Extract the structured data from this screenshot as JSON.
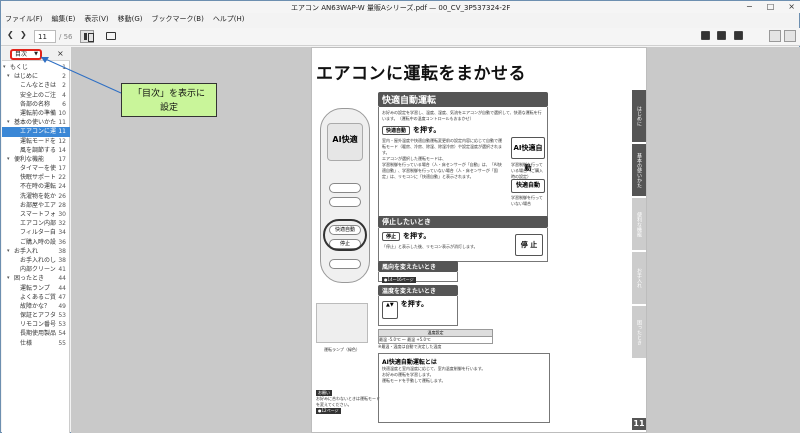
{
  "window": {
    "title": "エアコン AN63WAP-W 量販Aシリーズ.pdf — 00_CV_3P537324-2F",
    "buttons": [
      "−",
      "□",
      "×"
    ]
  },
  "menu": [
    "ファイル(F)",
    "編集(E)",
    "表示(V)",
    "移動(G)",
    "ブックマーク(B)",
    "ヘルプ(H)"
  ],
  "toolbar": {
    "back_icon": "chevron-left-icon",
    "forward_icon": "chevron-right-icon",
    "page_current": "11",
    "page_total": "/ 56"
  },
  "sidebar": {
    "selector_label": "目次",
    "toc": [
      {
        "label": "もくじ",
        "page": "1",
        "level": 0,
        "twisty": "▾"
      },
      {
        "label": "はじめに",
        "page": "2",
        "level": 1,
        "twisty": "▾"
      },
      {
        "label": "こんなときは",
        "page": "2",
        "level": 2
      },
      {
        "label": "安全上のご注意",
        "page": "4",
        "level": 2
      },
      {
        "label": "各部の名称",
        "page": "6",
        "level": 2
      },
      {
        "label": "運転前の準備",
        "page": "10",
        "level": 2
      },
      {
        "label": "基本の使いかた",
        "page": "11",
        "level": 1,
        "twisty": "▾"
      },
      {
        "label": "エアコンに運転をまかせる",
        "page": "11",
        "level": 2,
        "selected": true
      },
      {
        "label": "運転モードを選ぶ",
        "page": "12",
        "level": 2
      },
      {
        "label": "風を調節する",
        "page": "14",
        "level": 2
      },
      {
        "label": "便利な機能",
        "page": "17",
        "level": 1,
        "twisty": "▾"
      },
      {
        "label": "タイマーを使う",
        "page": "17",
        "level": 2
      },
      {
        "label": "快眠サポート",
        "page": "22",
        "level": 2
      },
      {
        "label": "不在時の運転",
        "page": "24",
        "level": 2
      },
      {
        "label": "洗濯物を乾かす",
        "page": "26",
        "level": 2
      },
      {
        "label": "お部屋やエアコンを",
        "page": "28",
        "level": 2
      },
      {
        "label": "スマートフォン",
        "page": "30",
        "level": 2
      },
      {
        "label": "エアコン内部",
        "page": "32",
        "level": 2
      },
      {
        "label": "フィルター自動",
        "page": "34",
        "level": 2
      },
      {
        "label": "ご購入時の設定",
        "page": "36",
        "level": 2
      },
      {
        "label": "お手入れ",
        "page": "38",
        "level": 1,
        "twisty": "▾"
      },
      {
        "label": "お手入れのしかた",
        "page": "38",
        "level": 2
      },
      {
        "label": "内部クリーン",
        "page": "41",
        "level": 2
      },
      {
        "label": "困ったとき",
        "page": "44",
        "level": 1,
        "twisty": "▾"
      },
      {
        "label": "運転ランプ",
        "page": "44",
        "level": 2
      },
      {
        "label": "よくあるご質問",
        "page": "47",
        "level": 2
      },
      {
        "label": "故障かな？",
        "page": "49",
        "level": 2
      },
      {
        "label": "保証とアフター",
        "page": "53",
        "level": 2
      },
      {
        "label": "リモコン番号",
        "page": "53",
        "level": 2
      },
      {
        "label": "長期使用製品",
        "page": "54",
        "level": 2
      },
      {
        "label": "仕様",
        "page": "55",
        "level": 2
      }
    ]
  },
  "annotation": {
    "line1": "「目次」を表示に",
    "line2": "設定"
  },
  "pdf": {
    "title": "エアコンに運転をまかせる",
    "sec1_head": "快適自動運転",
    "sec1_intro": "お好みの設定を学習し、温度、湿度、気流をエアコンが自動で選択して、快適な運転を行います。（運転中の温度コントロールもおまかせ）",
    "sec1_press": "を押す。",
    "sec1_btn": "快適自動",
    "sec1_note1": "室内・屋外温度や快適自動運転変更前の設定内容に応じて自動で運転モード（暖房、冷房、除湿、除湿冷房）や設定温度が選択されます。",
    "sec1_note2": "エアコンが選択した運転モードは、",
    "sec1_note3": "学習制御を行っている場合（人・床センサーが「自動」は、「AI快適自動」、学習制御を行っていない場合（人・床センサーが「固定」は、リモコンに「快適自動」と表示されます。",
    "ai_label": "AI快適自動",
    "ai_caption": "学習制御を行っている場合（ご購入時の設定）",
    "auto_label": "快適自動",
    "auto_caption": "学習制御を行っていない場合",
    "stop_head": "停止したいとき",
    "stop_btn": "停止",
    "stop_press": "を押す。",
    "stop_note": "「停止」と表示した後、リモコン表示が消灯します。",
    "stop_side": "停 止",
    "wind_head": "風向を変えたいとき",
    "wind_ref": "●14〜16ページ",
    "temp_head": "温度を変えたいとき",
    "temp_press": "を押す。",
    "temp_note": "温度設定",
    "temp_range": "最温 -5.0℃ 〜 最温 +5.0℃",
    "temp_sub": "※最温・温度は自動で決定した温度",
    "ai_head": "AI快適自動運転とは",
    "ai_b1": "快適温度と室内温度に応じて、室内温度制御を行います。",
    "ai_b2": "お好みの運転を学習します。",
    "ai_b3": "運転モードを手動して運転します。",
    "remote_disp": "AI快適",
    "remote_btn1": "快適自動",
    "remote_btn2": "停止",
    "lamp_label": "運転ランプ（緑色）",
    "memo_tag": "お願い",
    "memo_text": "お好みに合わないときは運転モードを変えてください。",
    "memo_ref": "●12ページ",
    "tabs": [
      "はじめに",
      "基本の使いかた",
      "便利な機能",
      "お手入れ",
      "困ったとき"
    ],
    "page_number": "11"
  }
}
